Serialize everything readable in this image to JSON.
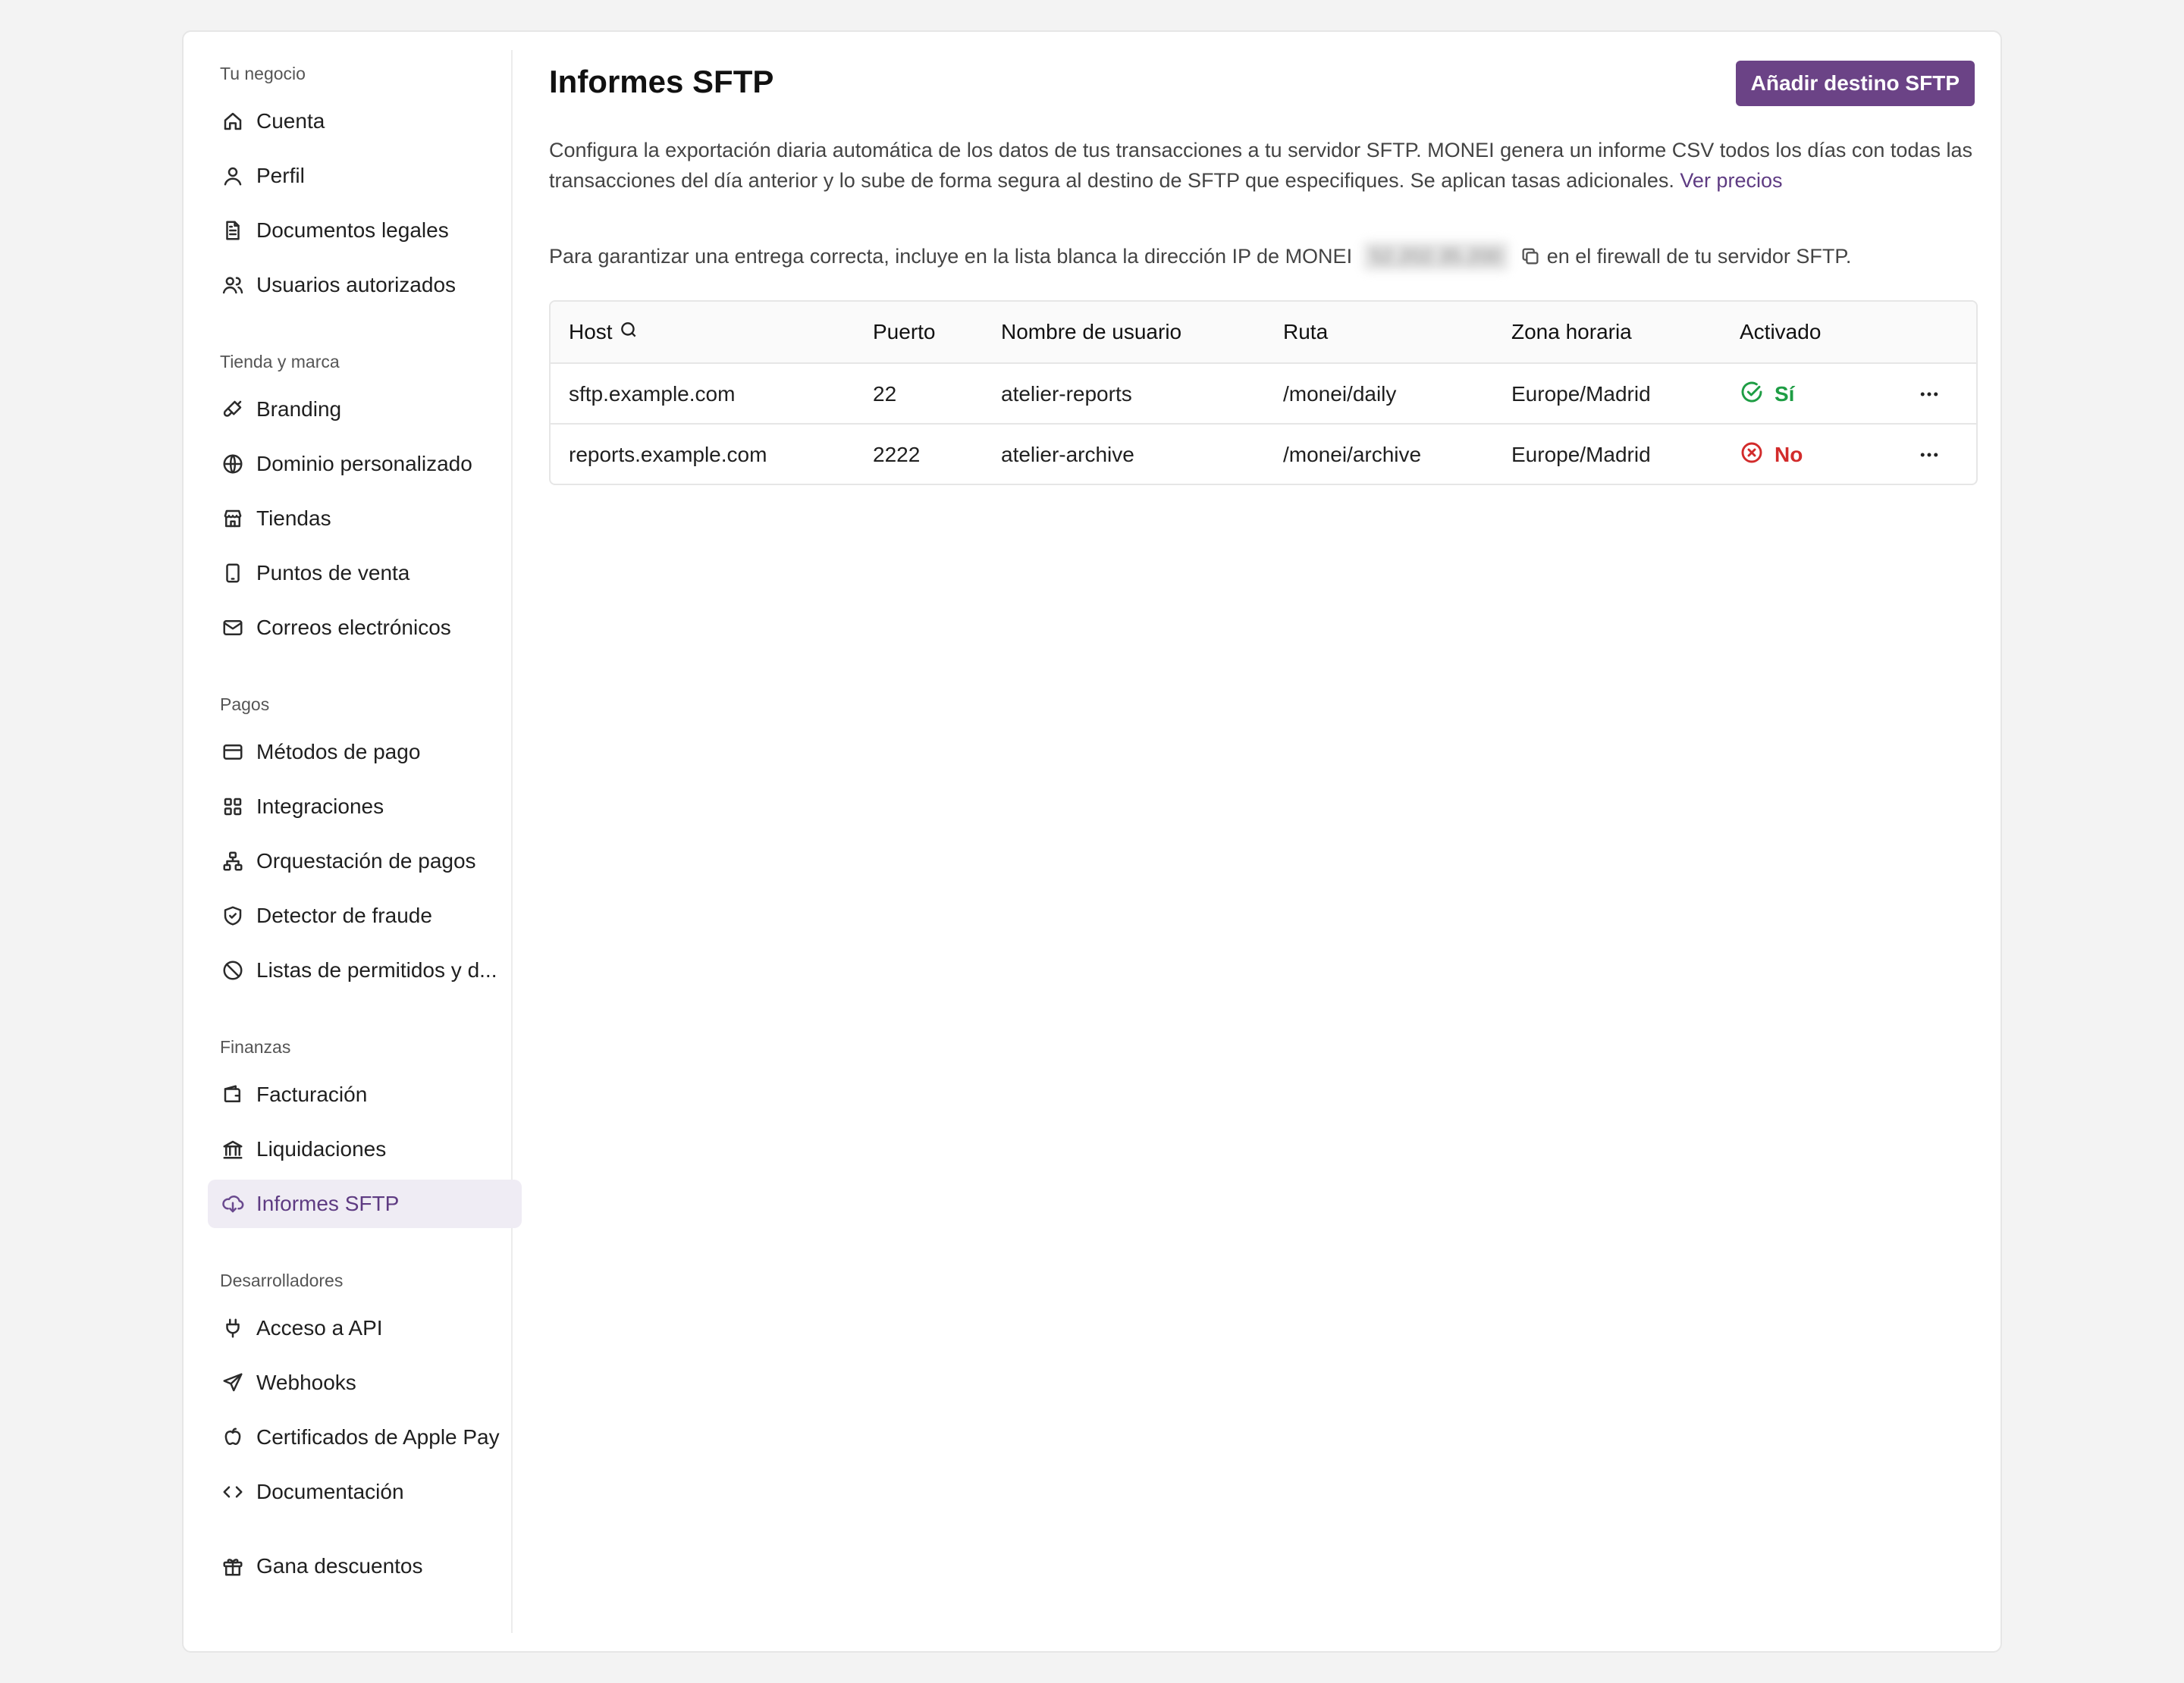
{
  "sidebar": {
    "sections": [
      {
        "title": "Tu negocio",
        "items": [
          {
            "label": "Cuenta",
            "icon": "home-icon"
          },
          {
            "label": "Perfil",
            "icon": "user-icon"
          },
          {
            "label": "Documentos legales",
            "icon": "document-icon"
          },
          {
            "label": "Usuarios autorizados",
            "icon": "users-icon"
          }
        ]
      },
      {
        "title": "Tienda y marca",
        "items": [
          {
            "label": "Branding",
            "icon": "brush-icon"
          },
          {
            "label": "Dominio personalizado",
            "icon": "globe-icon"
          },
          {
            "label": "Tiendas",
            "icon": "store-icon"
          },
          {
            "label": "Puntos de venta",
            "icon": "tablet-icon"
          },
          {
            "label": "Correos electrónicos",
            "icon": "mail-icon"
          }
        ]
      },
      {
        "title": "Pagos",
        "items": [
          {
            "label": "Métodos de pago",
            "icon": "credit-card-icon"
          },
          {
            "label": "Integraciones",
            "icon": "grid-icon"
          },
          {
            "label": "Orquestación de pagos",
            "icon": "network-icon"
          },
          {
            "label": "Detector de fraude",
            "icon": "shield-icon"
          },
          {
            "label": "Listas de permitidos y d...",
            "icon": "ban-icon"
          }
        ]
      },
      {
        "title": "Finanzas",
        "items": [
          {
            "label": "Facturación",
            "icon": "wallet-icon"
          },
          {
            "label": "Liquidaciones",
            "icon": "bank-icon"
          },
          {
            "label": "Informes SFTP",
            "icon": "cloud-download-icon",
            "active": true
          }
        ]
      },
      {
        "title": "Desarrolladores",
        "items": [
          {
            "label": "Acceso a API",
            "icon": "plug-icon"
          },
          {
            "label": "Webhooks",
            "icon": "send-icon"
          },
          {
            "label": "Certificados de Apple Pay",
            "icon": "apple-icon"
          },
          {
            "label": "Documentación",
            "icon": "code-icon"
          }
        ]
      }
    ],
    "footer_item": {
      "label": "Gana descuentos",
      "icon": "gift-icon"
    }
  },
  "header": {
    "title": "Informes SFTP",
    "add_button_label": "Añadir destino SFTP"
  },
  "description": {
    "text": "Configura la exportación diaria automática de los datos de tus transacciones a tu servidor SFTP. MONEI genera un informe CSV todos los días con todas las transacciones del día anterior y lo sube de forma segura al destino de SFTP que especifiques. Se aplican tasas adicionales.",
    "link_label": "Ver precios"
  },
  "ip_notice": {
    "before": "Para garantizar una entrega correcta, incluye en la lista blanca la dirección IP de MONEI",
    "ip_value": "52.202.35.200",
    "after": "en el firewall de tu servidor SFTP."
  },
  "table": {
    "columns": [
      "Host",
      "Puerto",
      "Nombre de usuario",
      "Ruta",
      "Zona horaria",
      "Activado"
    ],
    "rows": [
      {
        "host": "sftp.example.com",
        "port": "22",
        "user": "atelier-reports",
        "path": "/monei/daily",
        "tz": "Europe/Madrid",
        "enabled": "Sí",
        "status": "yes"
      },
      {
        "host": "reports.example.com",
        "port": "2222",
        "user": "atelier-archive",
        "path": "/monei/archive",
        "tz": "Europe/Madrid",
        "enabled": "No",
        "status": "no"
      }
    ]
  },
  "colors": {
    "accent": "#6b4386",
    "active_bg": "#efecf4",
    "success": "#1e9d44",
    "danger": "#d22b2b"
  }
}
